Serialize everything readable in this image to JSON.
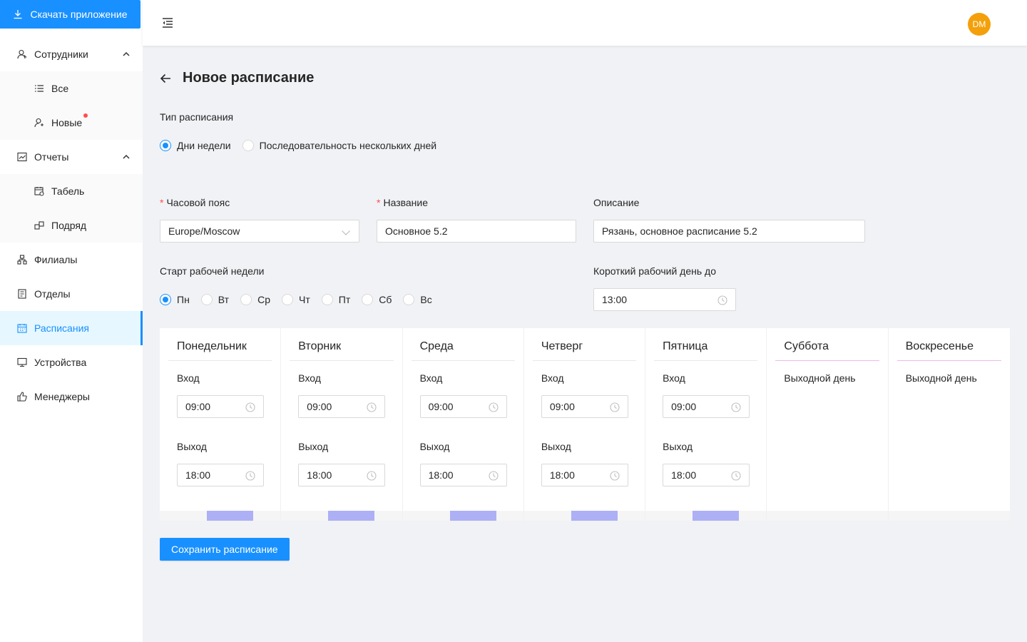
{
  "sidebar": {
    "download_label": "Скачать приложение",
    "employees": {
      "label": "Сотрудники",
      "all": "Все",
      "new": "Новые"
    },
    "reports": {
      "label": "Отчеты",
      "timesheet": "Табель",
      "contract": "Подряд"
    },
    "branches": "Филиалы",
    "departments": "Отделы",
    "schedules": "Расписания",
    "devices": "Устройства",
    "managers": "Менеджеры"
  },
  "header": {
    "avatar_initials": "DM"
  },
  "page": {
    "title": "Новое расписание",
    "schedule_type": {
      "label": "Тип расписания",
      "options": [
        "Дни недели",
        "Последовательность нескольких дней"
      ],
      "selected": "Дни недели"
    },
    "timezone": {
      "label": "Часовой пояс",
      "value": "Europe/Moscow"
    },
    "name": {
      "label": "Название",
      "value": "Основное 5.2"
    },
    "description": {
      "label": "Описание",
      "value": "Рязань, основное расписание 5.2"
    },
    "week_start": {
      "label": "Старт рабочей недели",
      "options": [
        "Пн",
        "Вт",
        "Ср",
        "Чт",
        "Пт",
        "Сб",
        "Вс"
      ],
      "selected": "Пн"
    },
    "short_day": {
      "label": "Короткий рабочий день до",
      "value": "13:00"
    },
    "days": [
      {
        "name": "Понедельник",
        "in_label": "Вход",
        "in": "09:00",
        "out_label": "Выход",
        "out": "18:00"
      },
      {
        "name": "Вторник",
        "in_label": "Вход",
        "in": "09:00",
        "out_label": "Выход",
        "out": "18:00"
      },
      {
        "name": "Среда",
        "in_label": "Вход",
        "in": "09:00",
        "out_label": "Выход",
        "out": "18:00"
      },
      {
        "name": "Четверг",
        "in_label": "Вход",
        "in": "09:00",
        "out_label": "Выход",
        "out": "18:00"
      },
      {
        "name": "Пятница",
        "in_label": "Вход",
        "in": "09:00",
        "out_label": "Выход",
        "out": "18:00"
      },
      {
        "name": "Суббота",
        "off_label": "Выходной день"
      },
      {
        "name": "Воскресенье",
        "off_label": "Выходной день"
      }
    ],
    "save_label": "Сохранить расписание"
  },
  "colors": {
    "primary": "#1890ff",
    "avatar": "#f4a00a",
    "day_bar": "#adb0f5",
    "weekend_line": "#eeb9e6"
  }
}
